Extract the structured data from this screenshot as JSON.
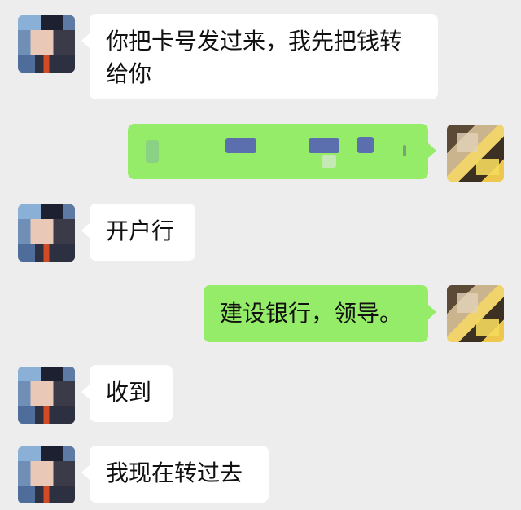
{
  "messages": [
    {
      "side": "left",
      "text": "你把卡号发过来，我先把钱转给你"
    },
    {
      "side": "right",
      "text": "",
      "note": "redacted card number"
    },
    {
      "side": "left",
      "text": "开户行"
    },
    {
      "side": "right",
      "text": "建设银行，领导。"
    },
    {
      "side": "left",
      "text": "收到"
    },
    {
      "side": "left",
      "text": "我现在转过去"
    }
  ],
  "colors": {
    "background": "#ededed",
    "sent_bubble": "#95ec69",
    "received_bubble": "#ffffff"
  }
}
